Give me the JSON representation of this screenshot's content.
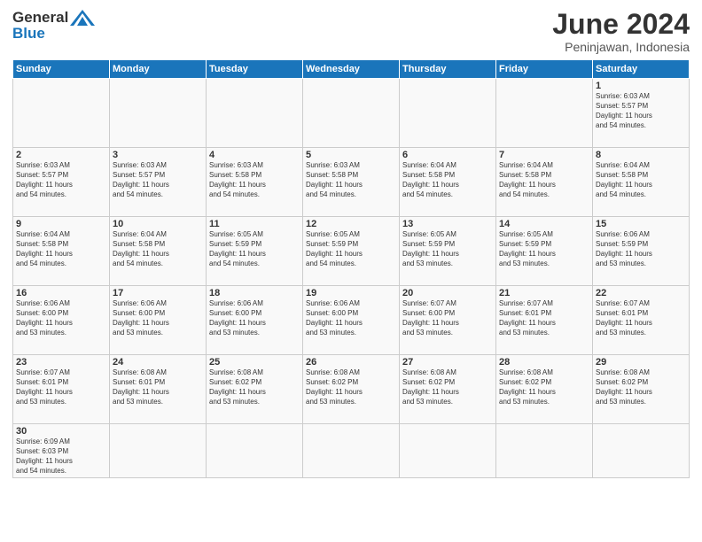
{
  "header": {
    "logo_general": "General",
    "logo_blue": "Blue",
    "month_title": "June 2024",
    "location": "Peninjawan, Indonesia"
  },
  "weekdays": [
    "Sunday",
    "Monday",
    "Tuesday",
    "Wednesday",
    "Thursday",
    "Friday",
    "Saturday"
  ],
  "weeks": [
    [
      {
        "day": "",
        "info": ""
      },
      {
        "day": "",
        "info": ""
      },
      {
        "day": "",
        "info": ""
      },
      {
        "day": "",
        "info": ""
      },
      {
        "day": "",
        "info": ""
      },
      {
        "day": "",
        "info": ""
      },
      {
        "day": "1",
        "info": "Sunrise: 6:03 AM\nSunset: 5:57 PM\nDaylight: 11 hours\nand 54 minutes."
      }
    ],
    [
      {
        "day": "2",
        "info": "Sunrise: 6:03 AM\nSunset: 5:57 PM\nDaylight: 11 hours\nand 54 minutes."
      },
      {
        "day": "3",
        "info": "Sunrise: 6:03 AM\nSunset: 5:57 PM\nDaylight: 11 hours\nand 54 minutes."
      },
      {
        "day": "4",
        "info": "Sunrise: 6:03 AM\nSunset: 5:58 PM\nDaylight: 11 hours\nand 54 minutes."
      },
      {
        "day": "5",
        "info": "Sunrise: 6:03 AM\nSunset: 5:58 PM\nDaylight: 11 hours\nand 54 minutes."
      },
      {
        "day": "6",
        "info": "Sunrise: 6:04 AM\nSunset: 5:58 PM\nDaylight: 11 hours\nand 54 minutes."
      },
      {
        "day": "7",
        "info": "Sunrise: 6:04 AM\nSunset: 5:58 PM\nDaylight: 11 hours\nand 54 minutes."
      },
      {
        "day": "8",
        "info": "Sunrise: 6:04 AM\nSunset: 5:58 PM\nDaylight: 11 hours\nand 54 minutes."
      }
    ],
    [
      {
        "day": "9",
        "info": "Sunrise: 6:04 AM\nSunset: 5:58 PM\nDaylight: 11 hours\nand 54 minutes."
      },
      {
        "day": "10",
        "info": "Sunrise: 6:04 AM\nSunset: 5:58 PM\nDaylight: 11 hours\nand 54 minutes."
      },
      {
        "day": "11",
        "info": "Sunrise: 6:05 AM\nSunset: 5:59 PM\nDaylight: 11 hours\nand 54 minutes."
      },
      {
        "day": "12",
        "info": "Sunrise: 6:05 AM\nSunset: 5:59 PM\nDaylight: 11 hours\nand 54 minutes."
      },
      {
        "day": "13",
        "info": "Sunrise: 6:05 AM\nSunset: 5:59 PM\nDaylight: 11 hours\nand 53 minutes."
      },
      {
        "day": "14",
        "info": "Sunrise: 6:05 AM\nSunset: 5:59 PM\nDaylight: 11 hours\nand 53 minutes."
      },
      {
        "day": "15",
        "info": "Sunrise: 6:06 AM\nSunset: 5:59 PM\nDaylight: 11 hours\nand 53 minutes."
      }
    ],
    [
      {
        "day": "16",
        "info": "Sunrise: 6:06 AM\nSunset: 6:00 PM\nDaylight: 11 hours\nand 53 minutes."
      },
      {
        "day": "17",
        "info": "Sunrise: 6:06 AM\nSunset: 6:00 PM\nDaylight: 11 hours\nand 53 minutes."
      },
      {
        "day": "18",
        "info": "Sunrise: 6:06 AM\nSunset: 6:00 PM\nDaylight: 11 hours\nand 53 minutes."
      },
      {
        "day": "19",
        "info": "Sunrise: 6:06 AM\nSunset: 6:00 PM\nDaylight: 11 hours\nand 53 minutes."
      },
      {
        "day": "20",
        "info": "Sunrise: 6:07 AM\nSunset: 6:00 PM\nDaylight: 11 hours\nand 53 minutes."
      },
      {
        "day": "21",
        "info": "Sunrise: 6:07 AM\nSunset: 6:01 PM\nDaylight: 11 hours\nand 53 minutes."
      },
      {
        "day": "22",
        "info": "Sunrise: 6:07 AM\nSunset: 6:01 PM\nDaylight: 11 hours\nand 53 minutes."
      }
    ],
    [
      {
        "day": "23",
        "info": "Sunrise: 6:07 AM\nSunset: 6:01 PM\nDaylight: 11 hours\nand 53 minutes."
      },
      {
        "day": "24",
        "info": "Sunrise: 6:08 AM\nSunset: 6:01 PM\nDaylight: 11 hours\nand 53 minutes."
      },
      {
        "day": "25",
        "info": "Sunrise: 6:08 AM\nSunset: 6:02 PM\nDaylight: 11 hours\nand 53 minutes."
      },
      {
        "day": "26",
        "info": "Sunrise: 6:08 AM\nSunset: 6:02 PM\nDaylight: 11 hours\nand 53 minutes."
      },
      {
        "day": "27",
        "info": "Sunrise: 6:08 AM\nSunset: 6:02 PM\nDaylight: 11 hours\nand 53 minutes."
      },
      {
        "day": "28",
        "info": "Sunrise: 6:08 AM\nSunset: 6:02 PM\nDaylight: 11 hours\nand 53 minutes."
      },
      {
        "day": "29",
        "info": "Sunrise: 6:08 AM\nSunset: 6:02 PM\nDaylight: 11 hours\nand 53 minutes."
      }
    ],
    [
      {
        "day": "30",
        "info": "Sunrise: 6:09 AM\nSunset: 6:03 PM\nDaylight: 11 hours\nand 54 minutes."
      },
      {
        "day": "",
        "info": ""
      },
      {
        "day": "",
        "info": ""
      },
      {
        "day": "",
        "info": ""
      },
      {
        "day": "",
        "info": ""
      },
      {
        "day": "",
        "info": ""
      },
      {
        "day": "",
        "info": ""
      }
    ]
  ]
}
